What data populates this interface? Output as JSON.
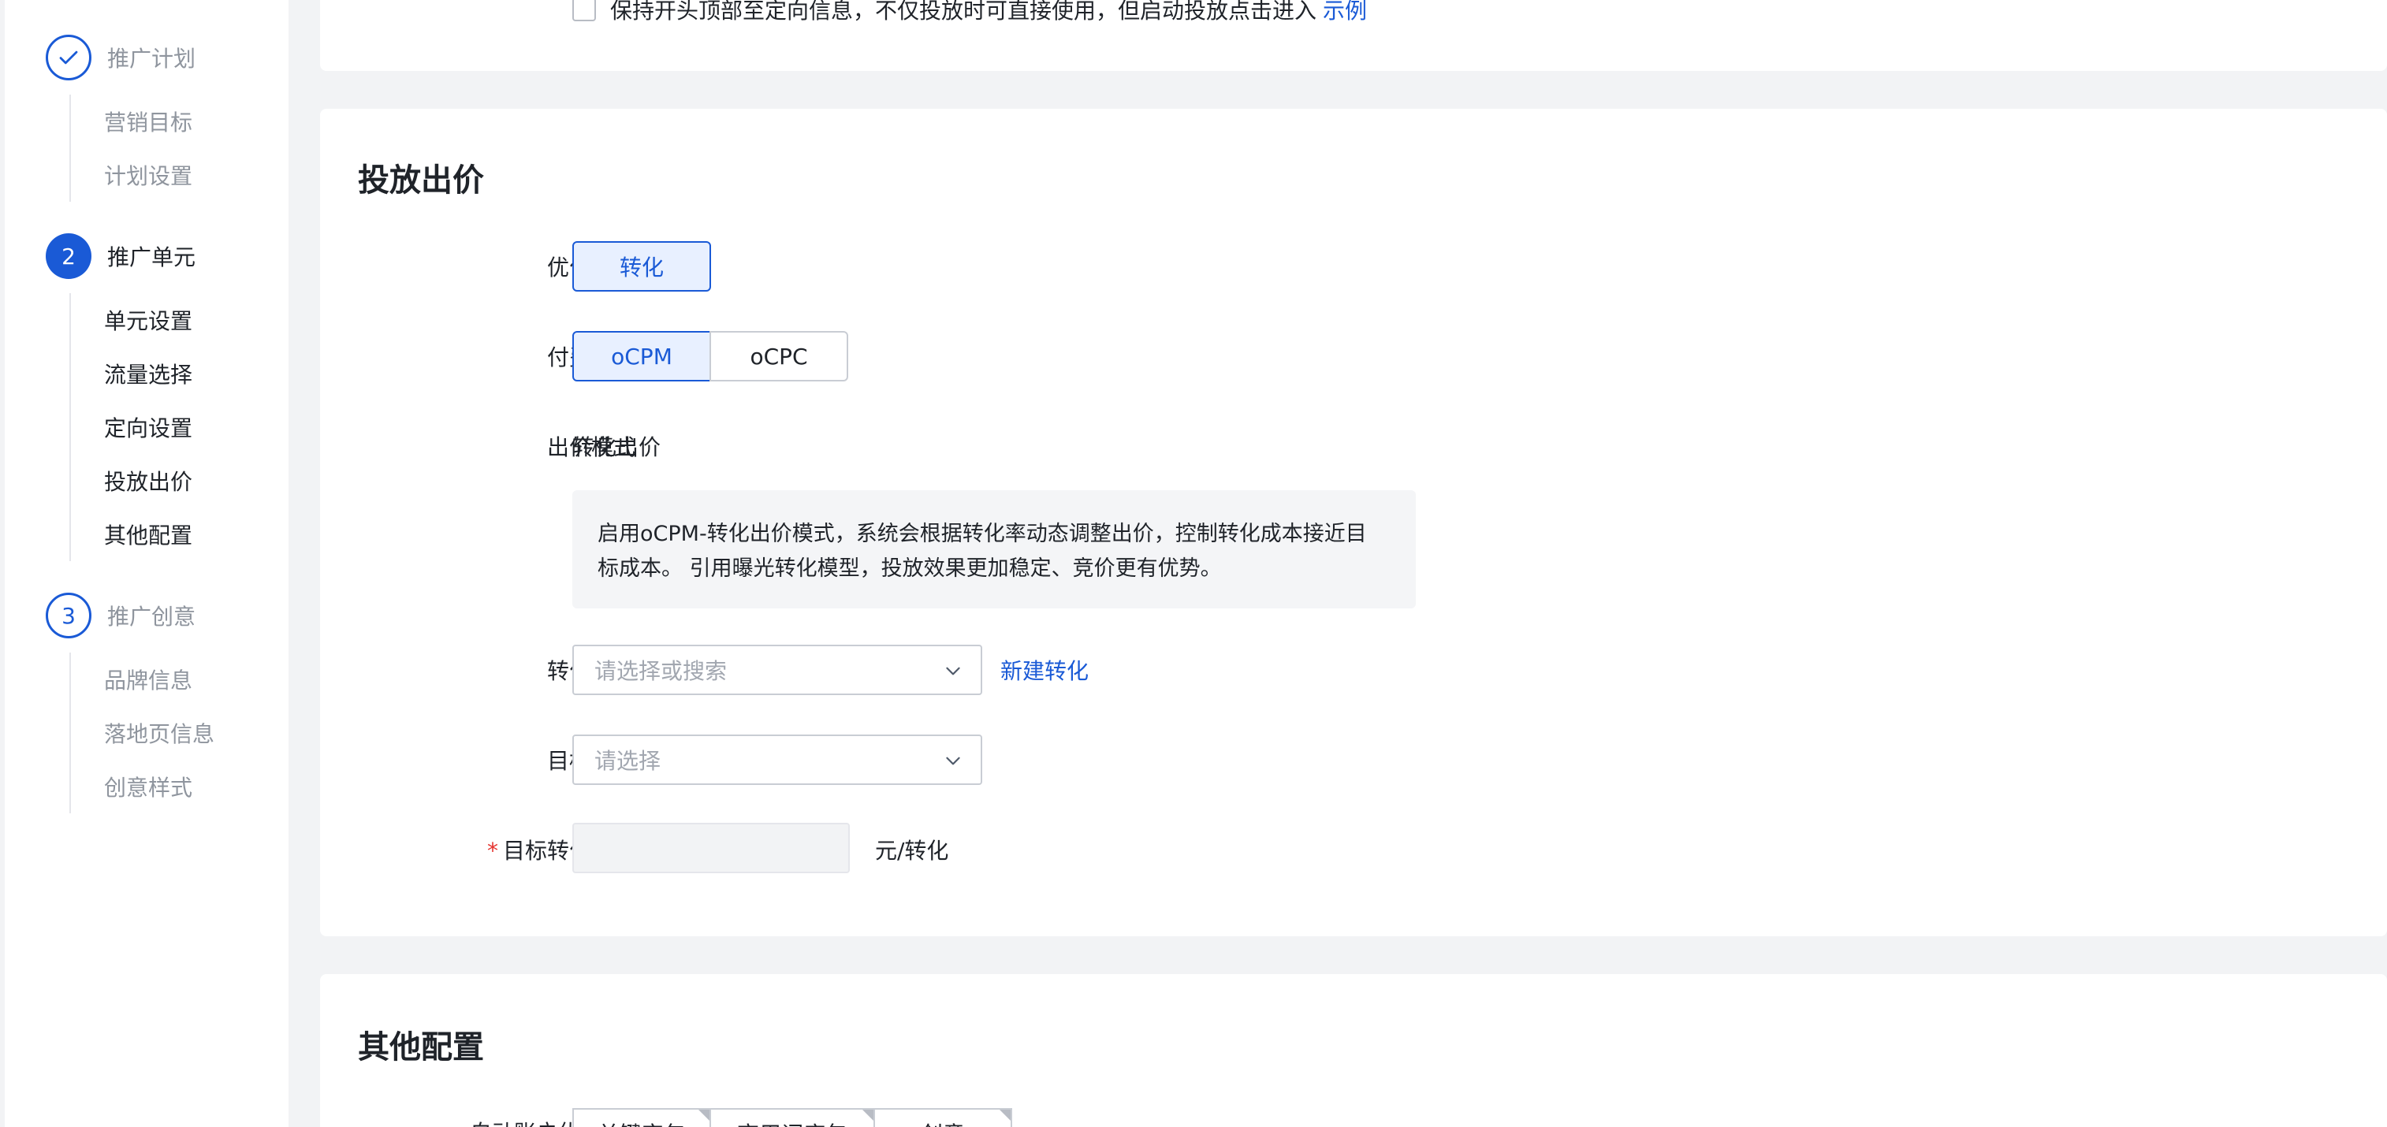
{
  "sidebar": {
    "steps": [
      {
        "index": "",
        "icon": "check-icon",
        "title": "推广计划",
        "substeps": [
          "营销目标",
          "计划设置"
        ]
      },
      {
        "index": "2",
        "title": "推广单元",
        "substeps": [
          "单元设置",
          "流量选择",
          "定向设置",
          "投放出价",
          "其他配置"
        ]
      },
      {
        "index": "3",
        "title": "推广创意",
        "substeps": [
          "品牌信息",
          "落地页信息",
          "创意样式"
        ]
      }
    ]
  },
  "top_card": {
    "checkbox_text": "保持开头顶部至定向信息，不仅投放时可直接使用，但启动投放点击进入",
    "trailing_link": "示例"
  },
  "bid_section": {
    "title": "投放出价",
    "optimize_goal": {
      "label": "优化目标",
      "options": [
        "转化"
      ],
      "selected": "转化"
    },
    "pay_mode": {
      "label": "付费模式",
      "options": [
        "oCPM",
        "oCPC"
      ],
      "selected": "oCPM"
    },
    "bid_mode": {
      "label": "出价模式",
      "value": "转化出价",
      "hint_line1": "启用oCPM-转化出价模式，系统会根据转化率动态调整出价，控制转化成本接近目",
      "hint_line2": "标成本。 引用曝光转化模型，投放效果更加稳定、竞价更有优势。"
    },
    "conversion_name": {
      "label": "转化名称",
      "placeholder": "请选择或搜索",
      "new_link": "新建转化"
    },
    "target_conversion": {
      "label": "目标转化",
      "placeholder": "请选择"
    },
    "target_bid": {
      "required_mark": "*",
      "label": "目标转化出价",
      "value": "",
      "unit": "元/转化"
    }
  },
  "other_section": {
    "title": "其他配置",
    "partial_row_label": "自动账户优化",
    "help_icon": "help-circle-icon",
    "tags": [
      "关键字包",
      "商用词库包",
      "创意"
    ]
  },
  "colors": {
    "accent": "#1a5ad6",
    "selected_bg": "#e8f0ff",
    "page_bg": "#f2f3f5",
    "required": "#e5322d"
  }
}
